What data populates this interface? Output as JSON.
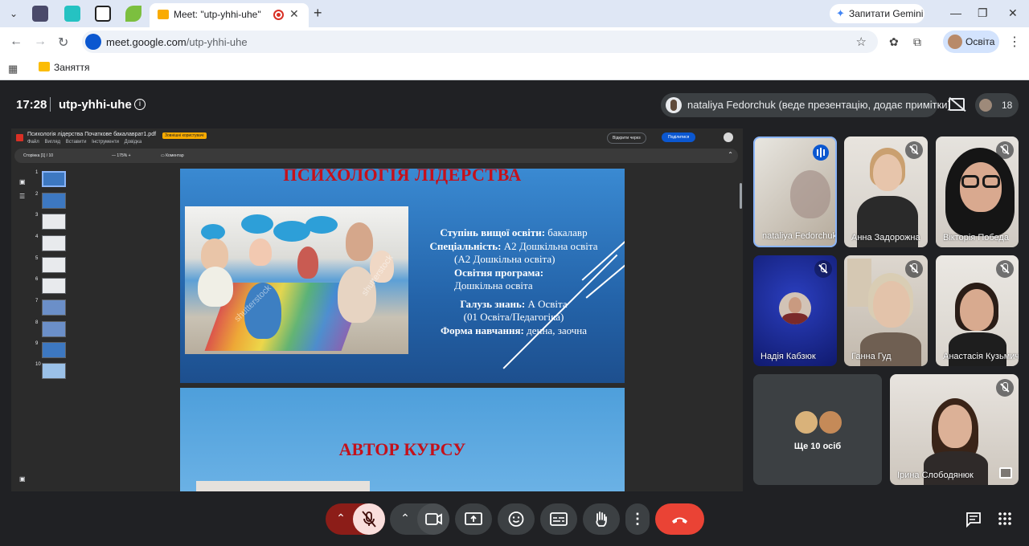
{
  "browser": {
    "active_tab_title": "Meet: \"utp-yhhi-uhe\"",
    "gemini_button": "Запитати Gemini",
    "url_host": "meet.google.com",
    "url_path": "/utp-yhhi-uhe",
    "profile_label": "Освіта",
    "bookmark_label": "Заняття"
  },
  "meet": {
    "time": "17:28",
    "meeting_code": "utp-yhhi-uhe",
    "presenter_text": "nataliya Fedorchuk (веде презентацію, додає примітки)",
    "participants_count": "18",
    "more_people": "Ще 10 осіб"
  },
  "pdf": {
    "filename": "Психологія лідерства Початкове бакалаврат1.pdf",
    "badge": "Зовнішні користувачі",
    "menu": [
      "Файл",
      "Вигляд",
      "Вставити",
      "Інструменти",
      "Довідка"
    ],
    "open_with": "Відкрити через",
    "share": "Поділитися",
    "page_label": "Сторінка",
    "page_current": "1",
    "page_total": "/ 10",
    "zoom": "175%",
    "comment": "Коментар",
    "thumb_numbers": [
      "1",
      "2",
      "3",
      "4",
      "5",
      "6",
      "7",
      "8",
      "9",
      "10"
    ]
  },
  "slide1": {
    "title": "ПСИХОЛОГІЯ ЛІДЕРСТВА",
    "watermark": "shutterstock",
    "l1_b": "Ступінь вищої освіти:",
    "l1": " бакалавр",
    "l2_b": "Спеціальність:",
    "l2": " А2 Дошкільна освіта",
    "l3": "(А2 Дошкільна освіта)",
    "l4_b": "Освітня програма:",
    "l5": "Дошкільна  освіта",
    "l6_b": "Галузь знань:",
    "l6": " А Освіта",
    "l7": "(01 Освіта/Педагогіка)",
    "l8_b": "Форма навчання:",
    "l8": " денна, заочна"
  },
  "slide2": {
    "title": "АВТОР КУРСУ"
  },
  "participants": [
    {
      "name": "nataliya Fedorchuk"
    },
    {
      "name": "Анна Задорожна"
    },
    {
      "name": "Вікторія Победа"
    },
    {
      "name": "Надія Кабзюк"
    },
    {
      "name": "Ганна Гуд"
    },
    {
      "name": "Анастасія Кузьмич"
    },
    {
      "name": "Ірина Слободянюк"
    }
  ],
  "colors": {
    "meet_bg": "#202124",
    "end_call": "#ea4335",
    "slide_title": "#c4111b",
    "slide_bg": "#2464aa"
  },
  "icons": [
    "search-icon",
    "mic-off-icon",
    "camera-icon",
    "present-icon",
    "emoji-icon",
    "captions-icon",
    "hand-icon",
    "more-icon",
    "call-end-icon",
    "chat-icon",
    "apps-icon"
  ]
}
